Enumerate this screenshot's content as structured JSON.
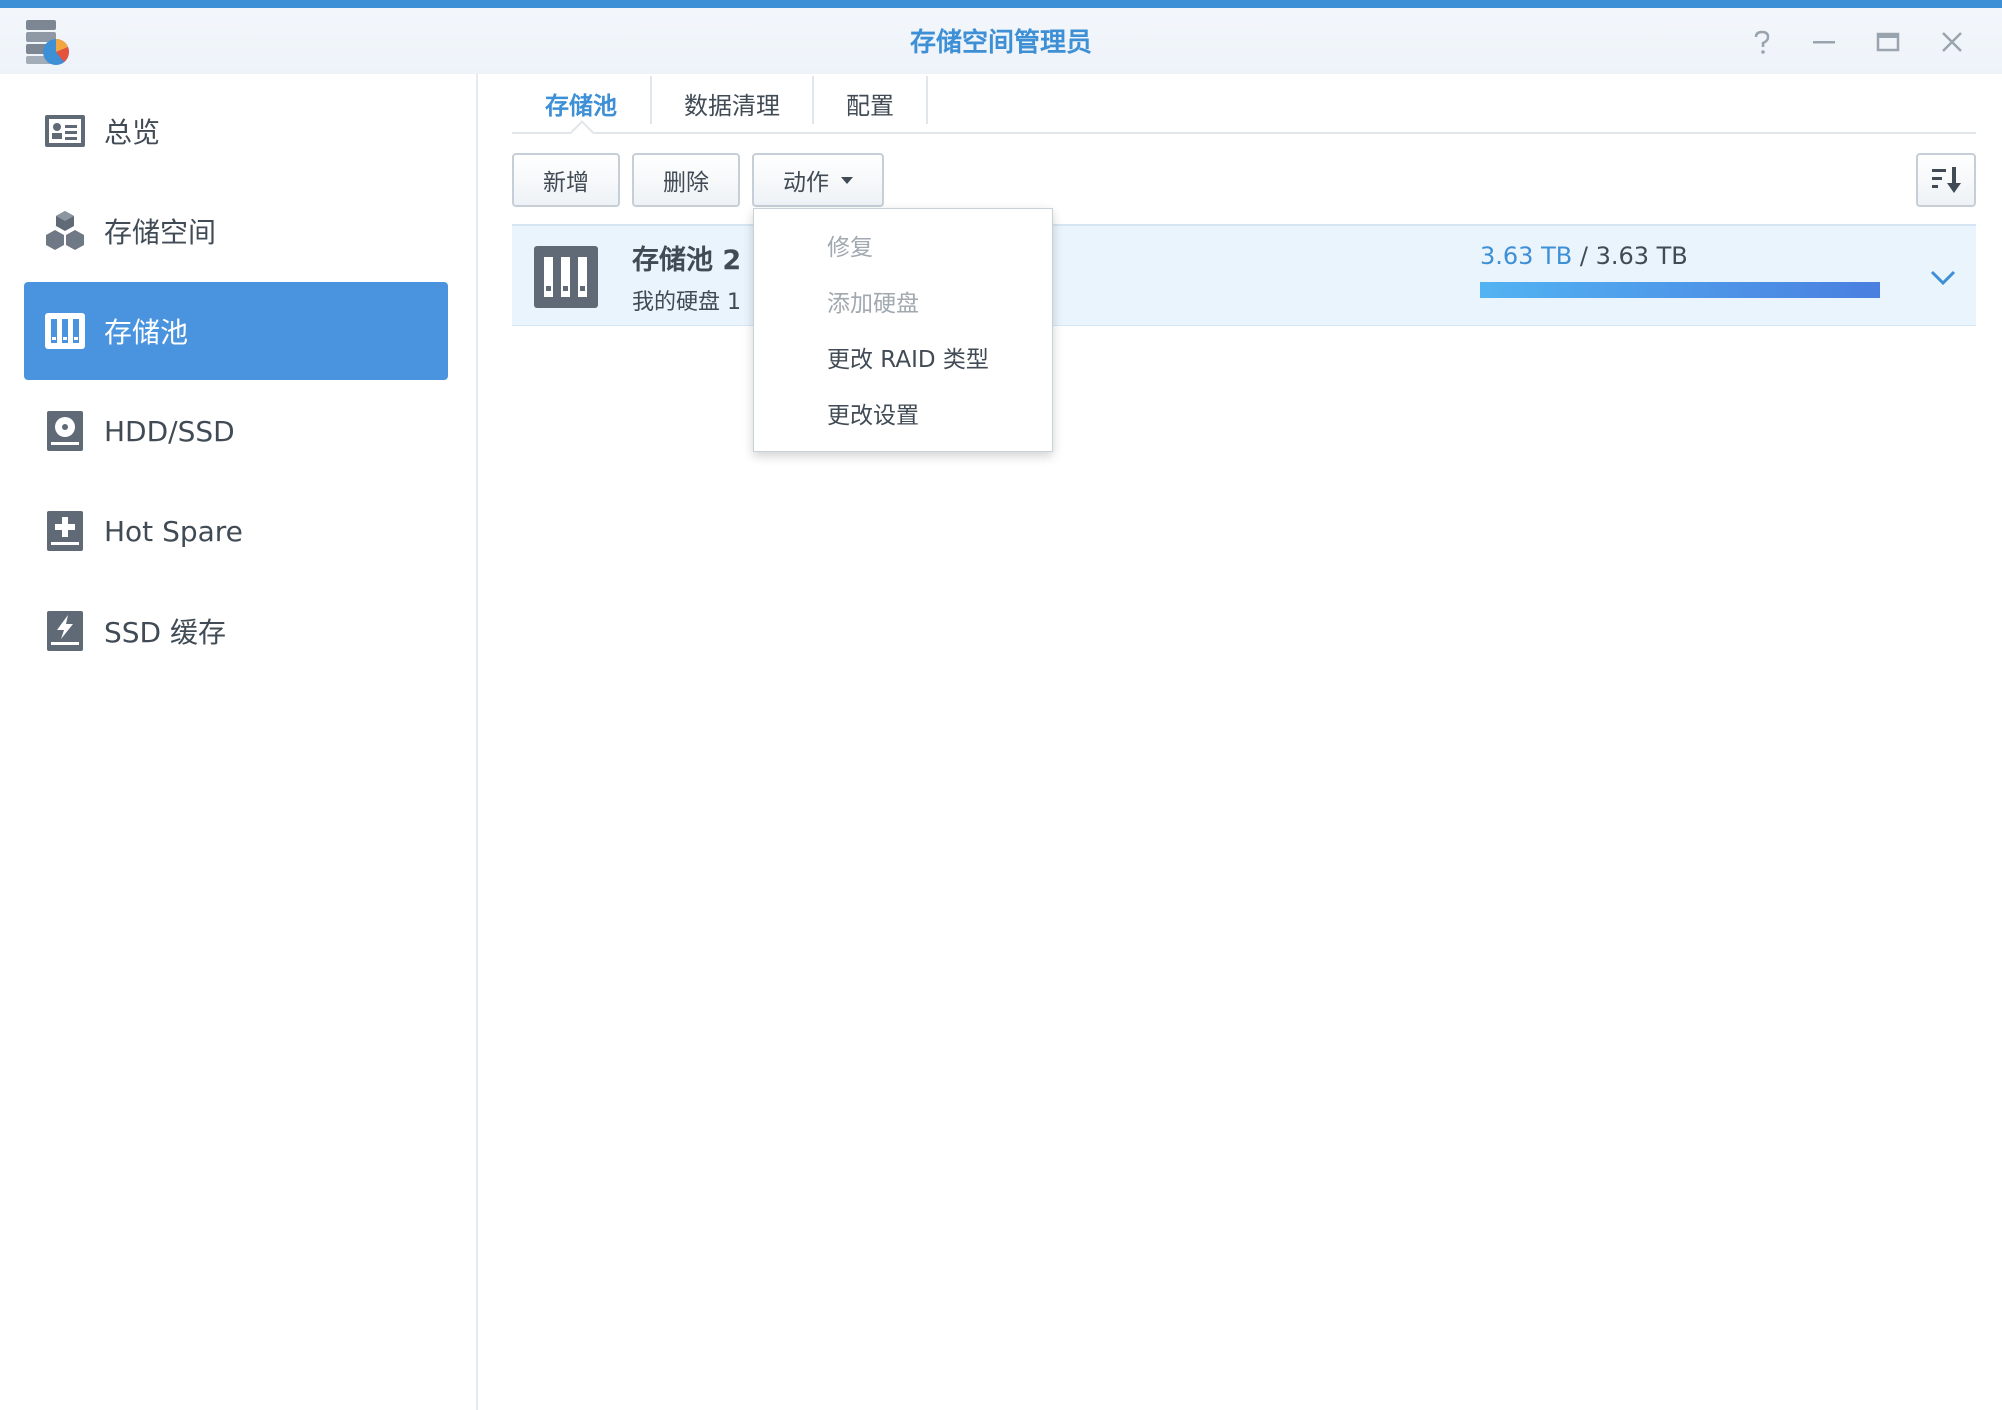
{
  "window": {
    "title": "存储空间管理员",
    "accent_color": "#3d8fd6",
    "controls": [
      "help-icon",
      "minimize-icon",
      "maximize-icon",
      "close-icon"
    ]
  },
  "sidebar": {
    "items": [
      {
        "label": "总览",
        "icon": "overview-icon",
        "active": false
      },
      {
        "label": "存储空间",
        "icon": "cubes-icon",
        "active": false
      },
      {
        "label": "存储池",
        "icon": "storage-pool-icon",
        "active": true
      },
      {
        "label": "HDD/SSD",
        "icon": "disk-icon",
        "active": false
      },
      {
        "label": "Hot Spare",
        "icon": "hot-spare-icon",
        "active": false
      },
      {
        "label": "SSD 缓存",
        "icon": "ssd-cache-icon",
        "active": false
      }
    ],
    "active_color": "#4a93de"
  },
  "tabs": [
    {
      "label": "存储池",
      "active": true
    },
    {
      "label": "数据清理",
      "active": false
    },
    {
      "label": "配置",
      "active": false
    }
  ],
  "toolbar": {
    "add_label": "新增",
    "delete_label": "删除",
    "action_label": "动作",
    "sort_icon": "sort-descending-icon"
  },
  "pool": {
    "name": "存储池 2",
    "description": "我的硬盘 1",
    "used": "3.63 TB",
    "separator": "/",
    "total": "3.63 TB",
    "usage_fraction": 1.0
  },
  "action_menu": {
    "items": [
      {
        "label": "修复",
        "enabled": false
      },
      {
        "label": "添加硬盘",
        "enabled": false
      },
      {
        "label": "更改 RAID 类型",
        "enabled": true
      },
      {
        "label": "更改设置",
        "enabled": true
      }
    ]
  }
}
